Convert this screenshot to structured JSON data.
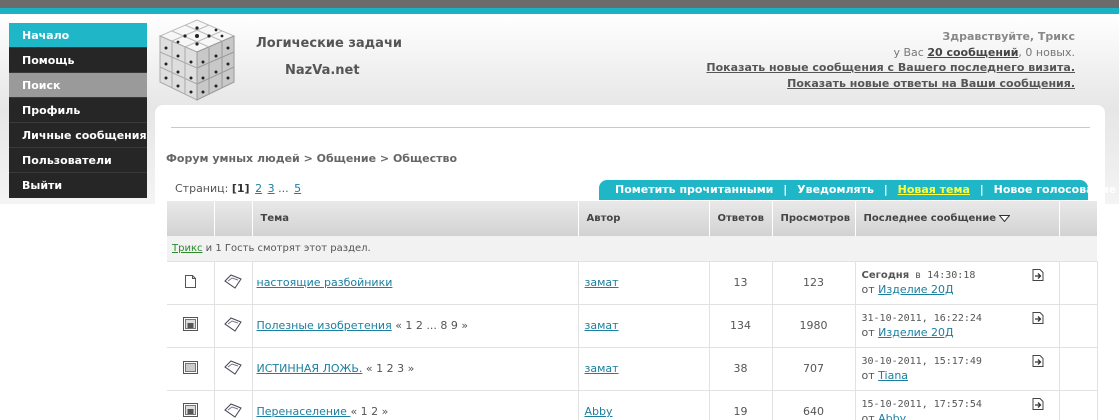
{
  "nav": {
    "items": [
      {
        "label": "Начало"
      },
      {
        "label": "Помощь"
      },
      {
        "label": "Поиск"
      },
      {
        "label": "Профиль"
      },
      {
        "label": "Личные сообщения"
      },
      {
        "label": "Пользователи"
      },
      {
        "label": "Выйти"
      }
    ]
  },
  "site": {
    "title": "Логические задачи",
    "subtitle": "NazVa.net"
  },
  "user": {
    "greeting": "Здравствуйте, Трикс",
    "msg_prefix": "у Вас",
    "msg_count": "20 сообщений",
    "msg_suffix": ", 0 новых.",
    "link_new_since": "Показать новые сообщения с Вашего последнего визита.",
    "link_new_replies": "Показать новые ответы на Ваши сообщения."
  },
  "breadcrumb": "Форум умных людей > Общение > Общество",
  "pages": {
    "label": "Страниц:",
    "current": "[1]",
    "p2": "2",
    "p3": "3",
    "ellipsis": "...",
    "p5": "5"
  },
  "actions": {
    "mark_read": "Пометить прочитанными",
    "notify": "Уведомлять",
    "new_topic": "Новая тема",
    "new_poll": "Новое голосование",
    "sep": "|"
  },
  "table": {
    "headers": {
      "topic": "Тема",
      "author": "Автор",
      "replies": "Ответов",
      "views": "Просмотров",
      "last": "Последнее сообщение"
    },
    "watching": {
      "user": "Трикс",
      "text": " и 1 Гость смотрят этот раздел."
    },
    "rows": [
      {
        "topic": "настоящие разбойники",
        "pages": "",
        "author": "замат",
        "replies": "13",
        "views": "123",
        "last_date_bold": "Сегодня",
        "last_date": " в 14:30:18",
        "last_by": "от",
        "last_user": "Изделие 20Д"
      },
      {
        "topic": "Полезные изобретения",
        "pages": "« 1 2 ... 8 9 »",
        "author": "замат",
        "replies": "134",
        "views": "1980",
        "last_date_bold": "",
        "last_date": "31-10-2011, 16:22:24",
        "last_by": "от",
        "last_user": "Изделие 20Д"
      },
      {
        "topic": "ИСТИННАЯ ЛОЖЬ.",
        "pages": "« 1 2 3 »",
        "author": "замат",
        "replies": "38",
        "views": "707",
        "last_date_bold": "",
        "last_date": "30-10-2011, 15:17:49",
        "last_by": "от",
        "last_user": "Tiana"
      },
      {
        "topic": "Перенаселение ",
        "pages": "« 1 2 »",
        "author": "Abby",
        "replies": "19",
        "views": "640",
        "last_date_bold": "",
        "last_date": "15-10-2011, 17:57:54",
        "last_by": "от",
        "last_user": "Abby"
      }
    ]
  }
}
